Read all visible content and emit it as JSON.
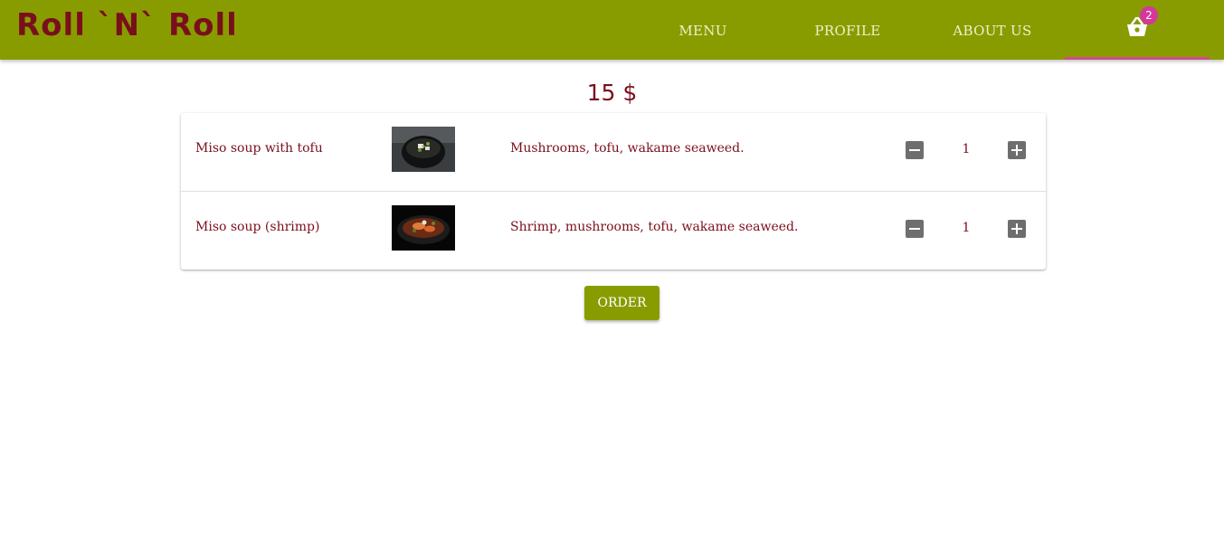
{
  "app": {
    "brand": "Roll `N` Roll"
  },
  "nav": {
    "menu": "MENU",
    "profile": "PROFILE",
    "about": "ABOUT US",
    "cart_icon": "basket-icon",
    "cart_count": "2"
  },
  "cart": {
    "total": "15 $",
    "items": [
      {
        "name": "Miso soup with tofu",
        "image_icon": "miso-soup-tofu-photo",
        "description": "Mushrooms, tofu, wakame seaweed.",
        "quantity": "1"
      },
      {
        "name": "Miso soup (shrimp)",
        "image_icon": "miso-soup-shrimp-photo",
        "description": "Shrimp, mushrooms, tofu, wakame seaweed.",
        "quantity": "1"
      }
    ],
    "order_label": "ORDER"
  },
  "colors": {
    "appbar": "#889c00",
    "brand_text": "#7a0f1c",
    "nav_text": "#f2efc8",
    "tab_indicator": "#d44a8a",
    "badge": "#d4389a",
    "body_text": "#7a0f1c",
    "qty_button": "#6e6e6e",
    "order_button": "#889c00"
  }
}
